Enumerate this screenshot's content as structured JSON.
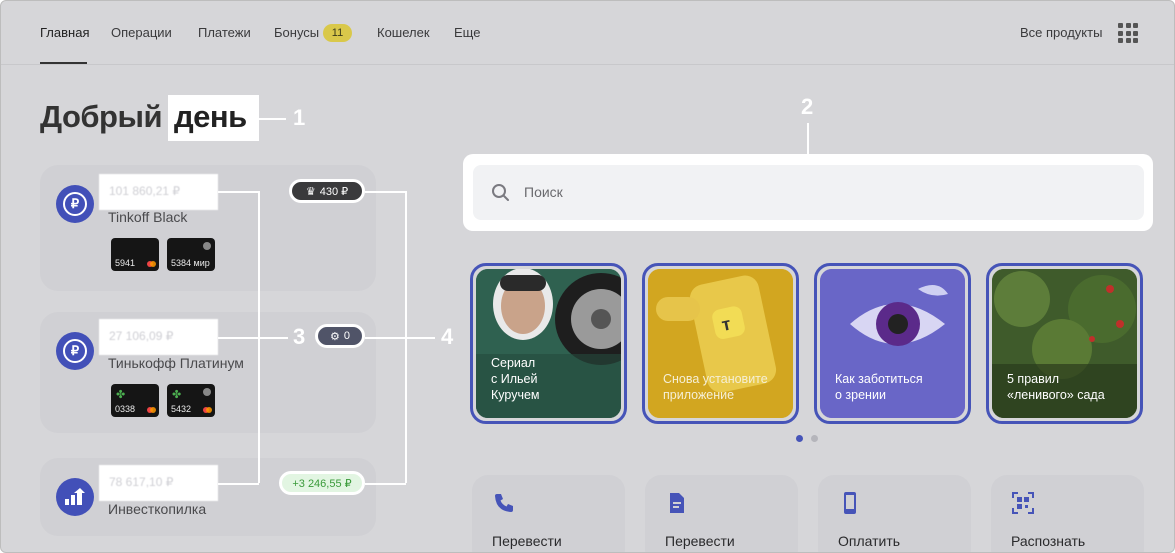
{
  "nav": {
    "items": [
      "Главная",
      "Операции",
      "Платежи",
      "Бонусы",
      "Кошелек",
      "Еще"
    ],
    "bonus_count": "11",
    "all_products": "Все продукты"
  },
  "greeting": {
    "first": "Добрый",
    "second": "день"
  },
  "callouts": [
    "1",
    "2",
    "3",
    "4"
  ],
  "accounts": [
    {
      "amount": "101 860,21 ₽",
      "name": "Tinkoff Black",
      "badge": "430 ₽",
      "cards": [
        "5941",
        "5384 мир"
      ]
    },
    {
      "amount": "27 106,09 ₽",
      "name": "Тинькофф Платинум",
      "badge": "0",
      "cards": [
        "0338",
        "5432"
      ]
    },
    {
      "amount": "78 617,10 ₽",
      "name": "Инвесткопилка",
      "badge": "+3 246,55 ₽"
    }
  ],
  "search": {
    "placeholder": "Поиск"
  },
  "stories": [
    {
      "text_lines": [
        "Сериал",
        "с Ильей",
        "Куручем"
      ]
    },
    {
      "text_lines": [
        "Снова установите",
        "приложение"
      ]
    },
    {
      "text_lines": [
        "Как заботиться",
        "о зрении"
      ]
    },
    {
      "text_lines": [
        "5 правил",
        "«ленивого» сада"
      ]
    }
  ],
  "actions": [
    "Перевести",
    "Перевести",
    "Оплатить",
    "Распознать"
  ],
  "colors": {
    "accent": "#4654b8",
    "background": "#d6d6d9"
  }
}
